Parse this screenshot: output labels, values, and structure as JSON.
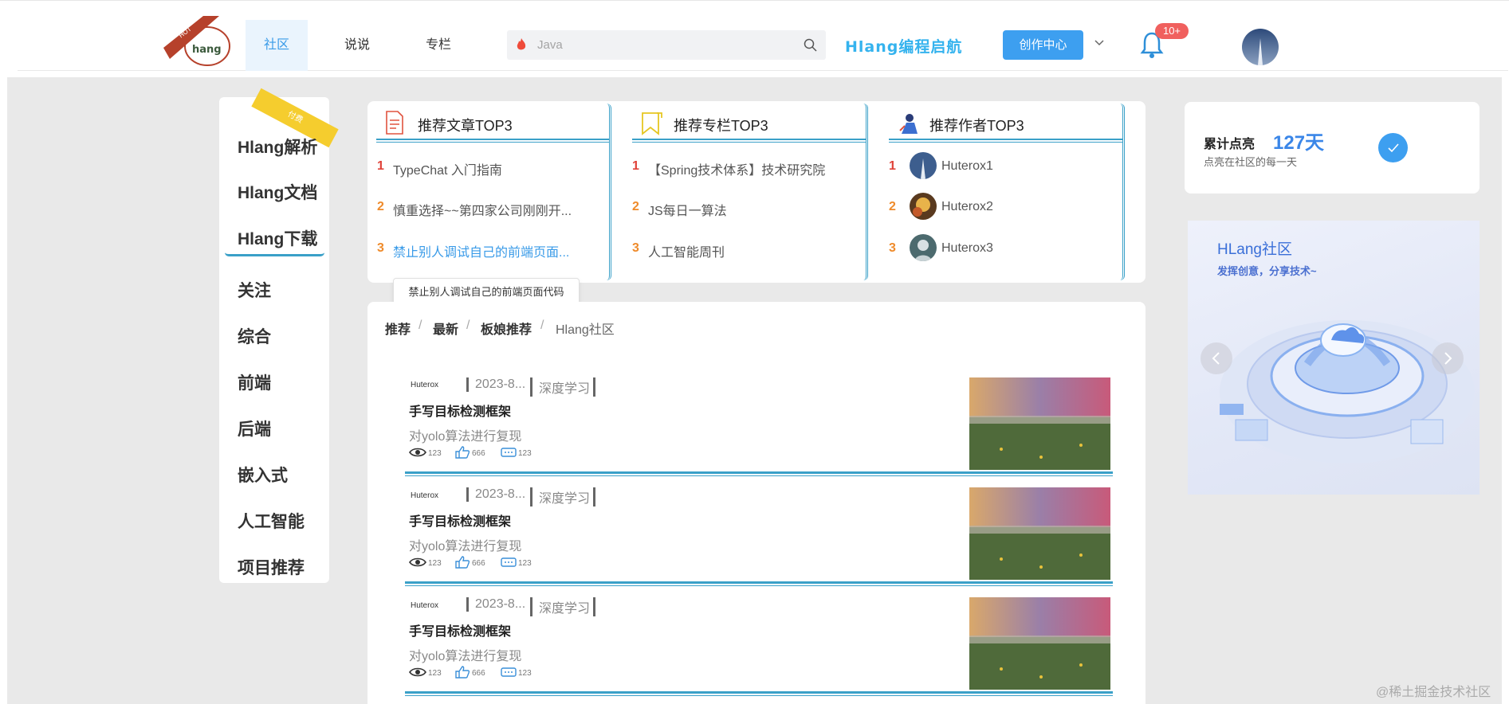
{
  "header": {
    "nav_tabs": [
      {
        "label": "社区",
        "active": true
      },
      {
        "label": "说说",
        "active": false
      },
      {
        "label": "专栏",
        "active": false
      }
    ],
    "search_placeholder": "Java",
    "brand_text": "Hlang编程启航",
    "create_button": "创作中心",
    "notification_count": "10+",
    "logo_badge": "HOT",
    "logo_text": "hang"
  },
  "sidebar": {
    "ribbon_text": "付费",
    "items": [
      {
        "label": "Hlang解析"
      },
      {
        "label": "Hlang文档"
      },
      {
        "label": "Hlang下载"
      },
      {
        "label": "关注"
      },
      {
        "label": "综合"
      },
      {
        "label": "前端"
      },
      {
        "label": "后端"
      },
      {
        "label": "嵌入式"
      },
      {
        "label": "人工智能"
      },
      {
        "label": "项目推荐"
      }
    ]
  },
  "top3": {
    "articles": {
      "title": "推荐文章TOP3",
      "items": [
        {
          "rank": "1",
          "text": "TypeChat 入门指南"
        },
        {
          "rank": "2",
          "text": "慎重选择~~第四家公司刚刚开..."
        },
        {
          "rank": "3",
          "text": "禁止别人调试自己的前端页面..."
        }
      ]
    },
    "columns": {
      "title": "推荐专栏TOP3",
      "items": [
        {
          "rank": "1",
          "text": "【Spring技术体系】技术研究院"
        },
        {
          "rank": "2",
          "text": "JS每日一算法"
        },
        {
          "rank": "3",
          "text": "人工智能周刊"
        }
      ]
    },
    "authors": {
      "title": "推荐作者TOP3",
      "items": [
        {
          "rank": "1",
          "text": "Huterox1"
        },
        {
          "rank": "2",
          "text": "Huterox2"
        },
        {
          "rank": "3",
          "text": "Huterox3"
        }
      ]
    },
    "tooltip": "禁止别人调试自己的前端页面代码"
  },
  "breadcrumb": {
    "items": [
      "推荐",
      "最新",
      "板娘推荐",
      "Hlang社区"
    ],
    "separator": "/"
  },
  "articles": [
    {
      "author": "Huterox",
      "date": "2023-8...",
      "tag": "深度学习",
      "title": "手写目标检测框架",
      "desc": "对yolo算法进行复现",
      "views": "123",
      "likes": "666",
      "comments": "123"
    },
    {
      "author": "Huterox",
      "date": "2023-8...",
      "tag": "深度学习",
      "title": "手写目标检测框架",
      "desc": "对yolo算法进行复现",
      "views": "123",
      "likes": "666",
      "comments": "123"
    },
    {
      "author": "Huterox",
      "date": "2023-8...",
      "tag": "深度学习",
      "title": "手写目标检测框架",
      "desc": "对yolo算法进行复现",
      "views": "123",
      "likes": "666",
      "comments": "123"
    }
  ],
  "checkin": {
    "title": "累计点亮",
    "days": "127天",
    "subtitle": "点亮在社区的每一天"
  },
  "banner": {
    "title": "HLang社区",
    "subtitle": "发挥创意，分享技术~"
  },
  "watermark": "@稀土掘金技术社区",
  "colors": {
    "accent": "#3d9ff0",
    "rule": "#3aa0c8",
    "rank1": "#e0433a",
    "rank23": "#ef8b2b",
    "brand": "#35b3ee"
  }
}
